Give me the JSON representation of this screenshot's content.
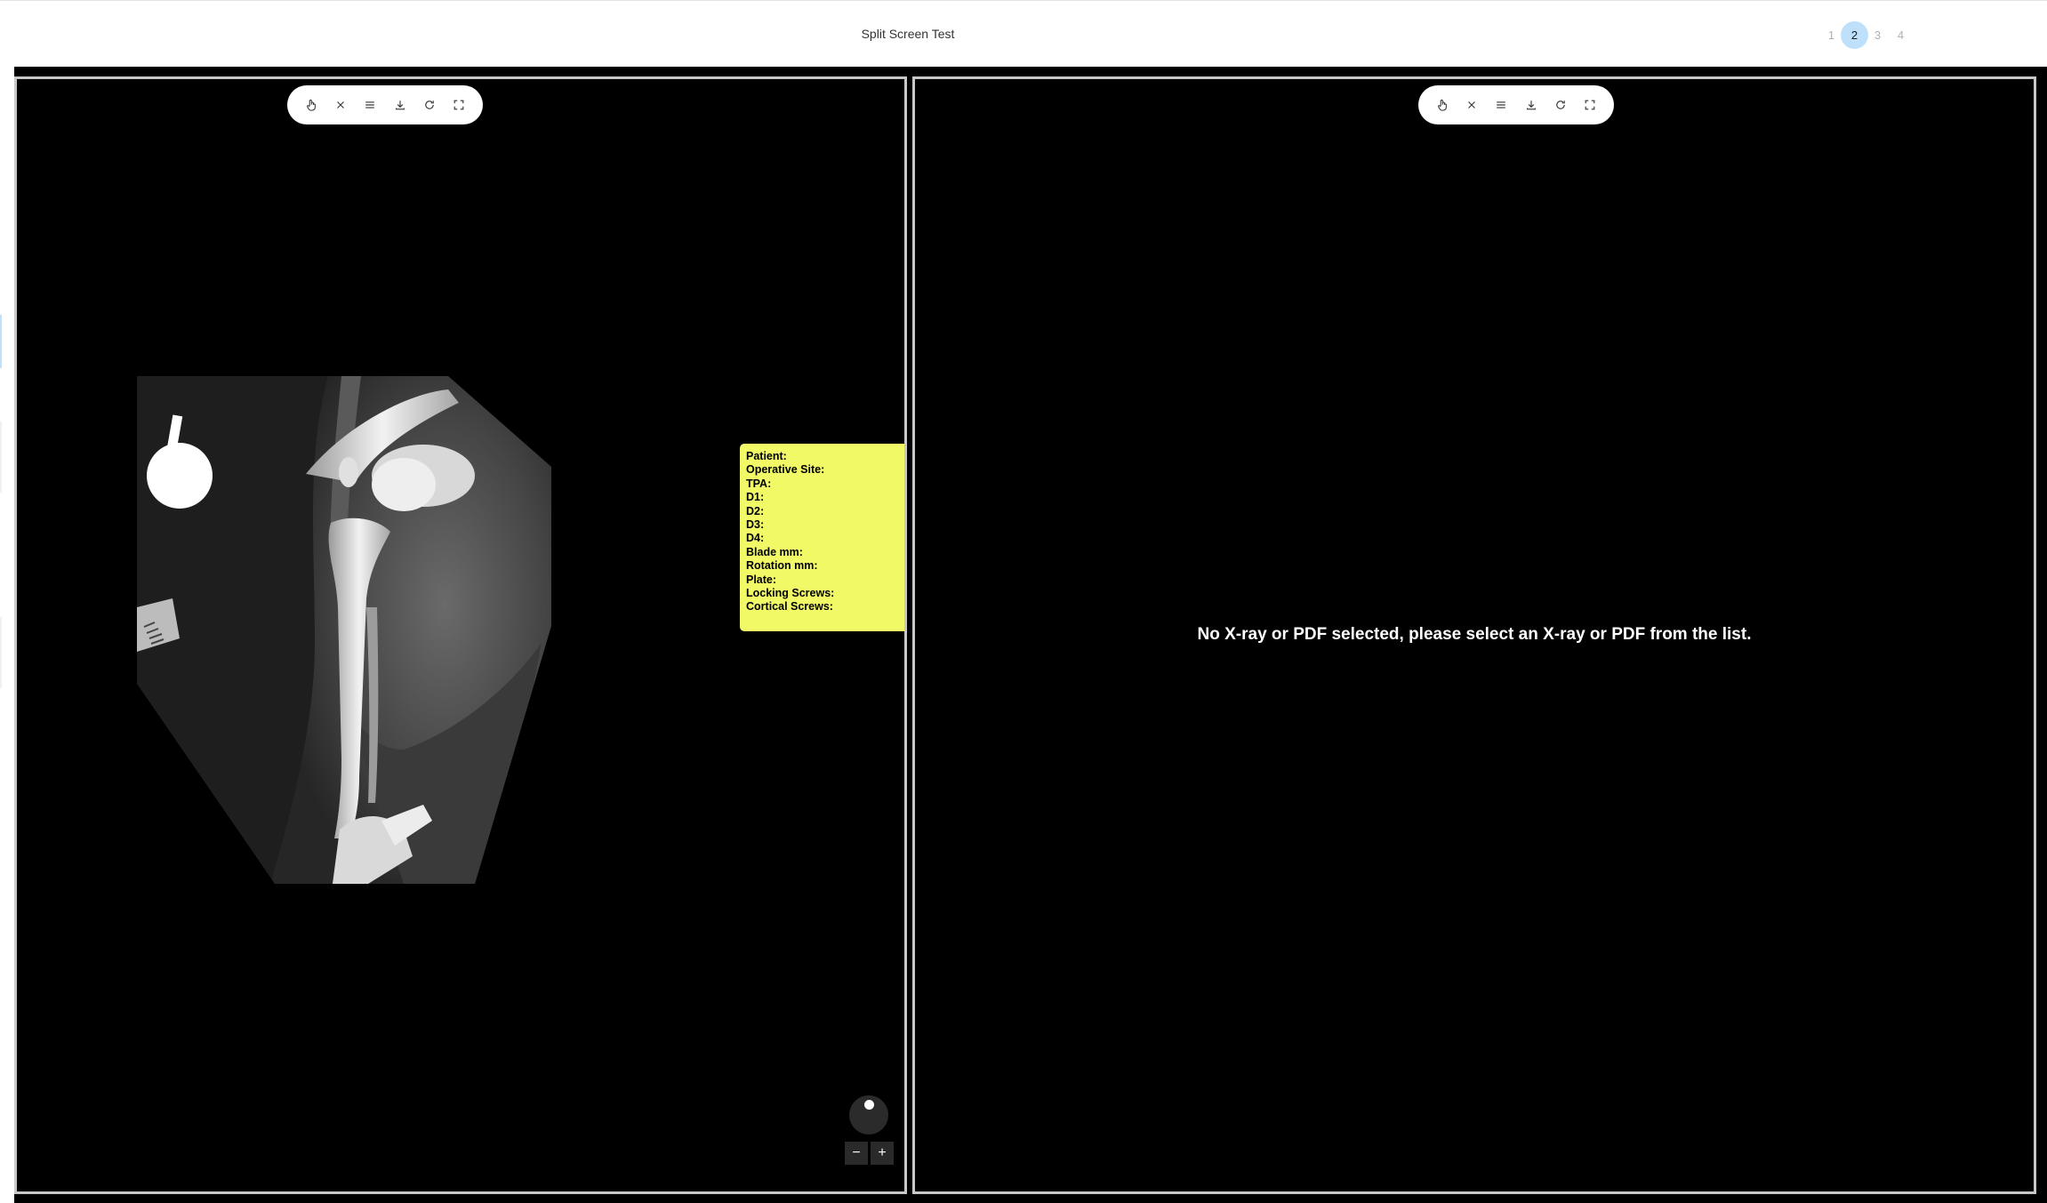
{
  "header": {
    "title": "Split Screen Test",
    "pages": [
      "1",
      "2",
      "3",
      "4"
    ],
    "active_page": "2"
  },
  "colors": {
    "note_background": "#f1f967",
    "active_page": "#bfe0fb",
    "panel_border": "#c8c8c8"
  },
  "left_panel": {
    "toolbar": [
      "hand-pointer-icon",
      "close-icon",
      "menu-icon",
      "download-icon",
      "rotate-icon",
      "fullscreen-icon"
    ],
    "note_lines": [
      "Patient:",
      "Operative Site:",
      "TPA:",
      "D1:",
      "D2:",
      "D3:",
      "D4:",
      "Blade mm:",
      "Rotation mm:",
      "Plate:",
      "Locking Screws:",
      "Cortical Screws:"
    ],
    "zoom_out": "−",
    "zoom_in": "+"
  },
  "right_panel": {
    "toolbar": [
      "hand-pointer-icon",
      "close-icon",
      "menu-icon",
      "download-icon",
      "rotate-icon",
      "fullscreen-icon"
    ],
    "message": "No X-ray or PDF selected, please select an X-ray or PDF from the list."
  }
}
